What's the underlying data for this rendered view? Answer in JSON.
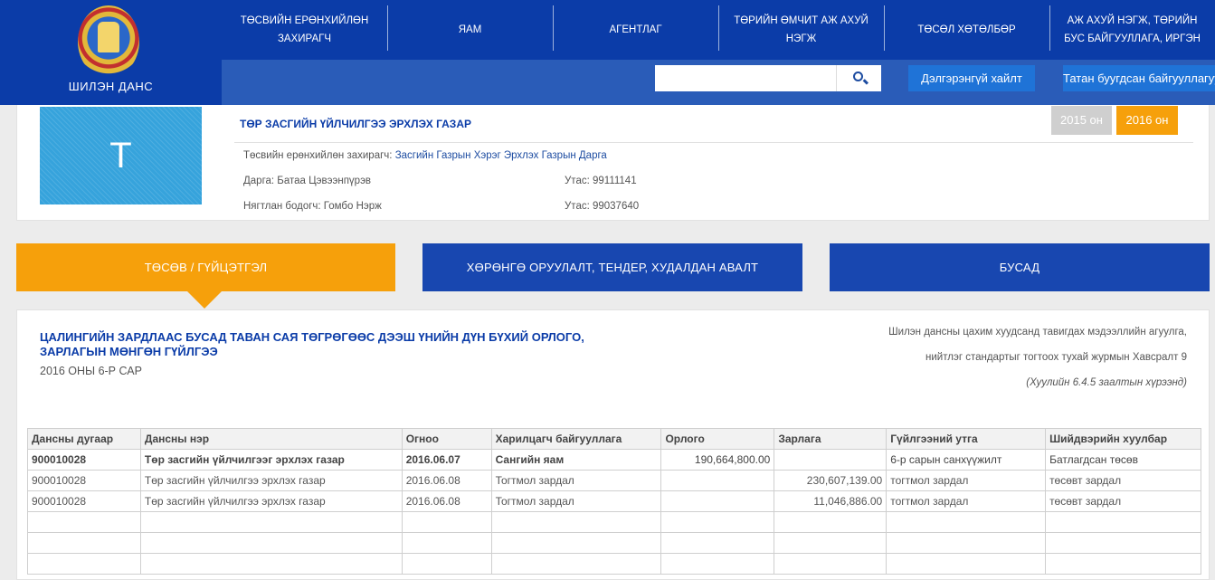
{
  "logo": {
    "text": "ШИЛЭН ДАНС"
  },
  "nav": [
    "ТӨСВИЙН ЕРӨНХИЙЛӨН ЗАХИРАГЧ",
    "ЯАМ",
    "АГЕНТЛАГ",
    "ТӨРИЙН ӨМЧИТ АЖ АХУЙ НЭГЖ",
    "ТӨСӨЛ ХӨТӨЛБӨР",
    "АЖ АХУЙ НЭГЖ, ТӨРИЙН БУС БАЙГУУЛЛАГА, ИРГЭН"
  ],
  "search": {
    "value": "",
    "advanced_label": "Дэлгэрэнгүй хайлт",
    "fund_label": "Татан буугдсан байгууллагууд"
  },
  "org": {
    "avatar_letter": "Т",
    "title": "ТӨР ЗАСГИЙН ҮЙЛЧИЛГЭЭ ЭРХЛЭХ ГАЗАР",
    "manager_label": "Төсвийн ерөнхийлөн захирагч:",
    "manager_link": "Засгийн Газрын Хэрэг Эрхлэх Газрын Дарга",
    "head": "Дарга: Батаа Цэвээнпүрэв",
    "head_phone": "Утас: 99111141",
    "accountant": "Нягтлан бодогч: Гомбо Нэрж",
    "accountant_phone": "Утас: 99037640",
    "year_2015": "2015 он",
    "year_2016": "2016 он"
  },
  "tabs": {
    "budget": "ТӨСӨВ / ГҮЙЦЭТГЭЛ",
    "investment": "ХӨРӨНГӨ ОРУУЛАЛТ, ТЕНДЕР, ХУДАЛДАН АВАЛТ",
    "other": "БУСАД"
  },
  "report": {
    "title": "ЦАЛИНГИЙН ЗАРДЛААС БУСАД ТАВАН САЯ ТӨГРӨГӨӨС ДЭЭШ ҮНИЙН ДҮН БҮХИЙ ОРЛОГО, ЗАРЛАГЫН МӨНГӨН ГҮЙЛГЭЭ",
    "subtitle": "2016 ОНЫ 6-Р САР",
    "note1": "Шилэн дансны цахим хуудсанд тавигдах мэдээллийн агуулга,",
    "note2": "нийтлэг стандартыг тогтоох тухай журмын Хавсралт 9",
    "note3": "(Хуулийн 6.4.5 заалтын хүрээнд)"
  },
  "table": {
    "headers": [
      "Дансны дугаар",
      "Дансны нэр",
      "Огноо",
      "Харилцагч байгууллага",
      "Орлого",
      "Зарлага",
      "Гүйлгээний утга",
      "Шийдвэрийн хуулбар"
    ],
    "rows": [
      [
        "900010028",
        "Төр засгийн үйлчилгээг эрхлэх газар",
        "2016.06.07",
        "Сангийн яам",
        "190,664,800.00",
        "",
        "6-р сарын санхүүжилт",
        "Батлагдсан төсөв"
      ],
      [
        "900010028",
        "Төр засгийн үйлчилгээ эрхлэх газар",
        "2016.06.08",
        "Тогтмол зардал",
        "",
        "230,607,139.00",
        "тогтмол зардал",
        "төсөвт зардал"
      ],
      [
        "900010028",
        "Төр засгийн үйлчилгээ эрхлэх газар",
        "2016.06.08",
        "Тогтмол зардал",
        "",
        "11,046,886.00",
        "тогтмол зардал",
        "төсөвт зардал"
      ]
    ]
  }
}
